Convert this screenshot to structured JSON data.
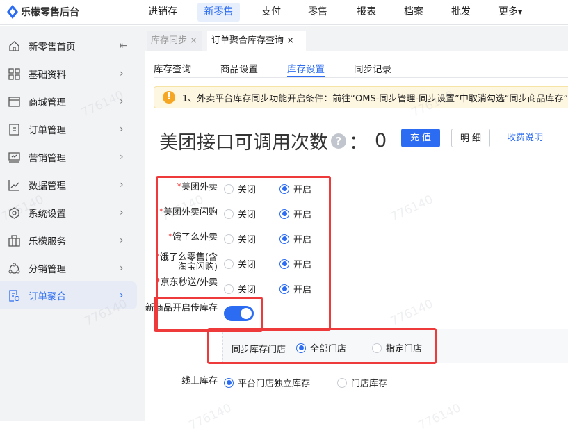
{
  "header": {
    "app_name": "乐檬零售后台",
    "nav": [
      "进销存",
      "新零售",
      "支付",
      "零售",
      "报表",
      "档案",
      "批发",
      "更多"
    ],
    "active_nav": "新零售"
  },
  "sidebar": {
    "items": [
      {
        "label": "新零售首页",
        "icon": "home-icon"
      },
      {
        "label": "基础资料",
        "icon": "grid-icon"
      },
      {
        "label": "商城管理",
        "icon": "store-icon"
      },
      {
        "label": "订单管理",
        "icon": "document-icon"
      },
      {
        "label": "营销管理",
        "icon": "monitor-icon"
      },
      {
        "label": "数据管理",
        "icon": "chart-icon"
      },
      {
        "label": "系统设置",
        "icon": "hexagon-gear-icon"
      },
      {
        "label": "乐檬服务",
        "icon": "briefcase-icon"
      },
      {
        "label": "分销管理",
        "icon": "share-icon"
      },
      {
        "label": "订单聚合",
        "icon": "order-settings-icon"
      }
    ],
    "active": "订单聚合"
  },
  "page_tabs": [
    {
      "label": "库存同步",
      "close": "×"
    },
    {
      "label": "订单聚合库存查询",
      "close": "×"
    }
  ],
  "sub_tabs": [
    "库存查询",
    "商品设置",
    "库存设置",
    "同步记录"
  ],
  "active_sub_tab": "库存设置",
  "alert": "1、外卖平台库存同步功能开启条件：前往“OMS-同步管理-同步设置”中取消勾选“同步商品库存”",
  "quota": {
    "title": "美团接口可调用次数",
    "help": "?",
    "colon": "：",
    "value": "0",
    "recharge": "充 值",
    "detail": "明 细",
    "fee_link": "收费说明"
  },
  "platforms": [
    {
      "label": "美团外卖",
      "required": true,
      "off": "关闭",
      "on": "开启",
      "value": "on"
    },
    {
      "label": "美团外卖闪购",
      "required": true,
      "off": "关闭",
      "on": "开启",
      "value": "on"
    },
    {
      "label": "饿了么外卖",
      "required": true,
      "off": "关闭",
      "on": "开启",
      "value": "on"
    },
    {
      "label": "饿了么零售(含淘宝闪购)",
      "required": true,
      "off": "关闭",
      "on": "开启",
      "value": "on"
    },
    {
      "label": "京东秒送/外卖",
      "required": true,
      "off": "关闭",
      "on": "开启",
      "value": "on"
    }
  ],
  "new_product_toggle": {
    "label": "新商品开启传库存",
    "value": true
  },
  "sync_store": {
    "label": "同步库存门店",
    "options": [
      "全部门店",
      "指定门店"
    ],
    "selected": "全部门店"
  },
  "online_stock": {
    "label": "线上库存",
    "options": [
      "平台门店独立库存",
      "门店库存"
    ],
    "selected": "平台门店独立库存"
  },
  "watermark": "776140",
  "colors": {
    "primary": "#2b6cf2",
    "highlight_box": "#ee3a3a",
    "warning": "#f5a623"
  }
}
